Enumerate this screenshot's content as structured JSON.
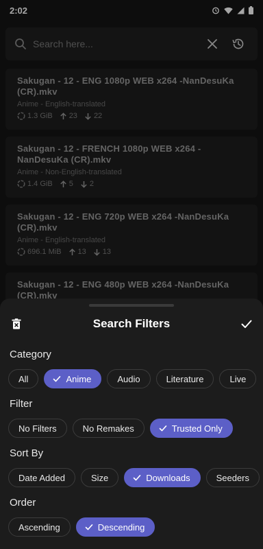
{
  "status": {
    "time": "2:02"
  },
  "search": {
    "placeholder": "Search here..."
  },
  "results": [
    {
      "title": "Sakugan - 12 - ENG 1080p WEB x264 -NanDesuKa (CR).mkv",
      "category": "Anime - English-translated",
      "size": "1.3 GiB",
      "seeders": "23",
      "leechers": "22"
    },
    {
      "title": "Sakugan - 12 - FRENCH 1080p WEB x264 -NanDesuKa (CR).mkv",
      "category": "Anime - Non-English-translated",
      "size": "1.4 GiB",
      "seeders": "5",
      "leechers": "2"
    },
    {
      "title": "Sakugan - 12 - ENG 720p WEB x264 -NanDesuKa (CR).mkv",
      "category": "Anime - English-translated",
      "size": "696.1 MiB",
      "seeders": "13",
      "leechers": "13"
    },
    {
      "title": "Sakugan - 12 - ENG 480p WEB x264 -NanDesuKa (CR).mkv",
      "category": "",
      "size": "",
      "seeders": "",
      "leechers": ""
    }
  ],
  "sheet": {
    "title": "Search Filters",
    "category_label": "Category",
    "categories": [
      "All",
      "Anime",
      "Audio",
      "Literature",
      "Live"
    ],
    "filter_label": "Filter",
    "filters": [
      "No Filters",
      "No Remakes",
      "Trusted Only"
    ],
    "sort_label": "Sort By",
    "sorts": [
      "Date Added",
      "Size",
      "Downloads",
      "Seeders"
    ],
    "order_label": "Order",
    "orders": [
      "Ascending",
      "Descending"
    ]
  },
  "colors": {
    "accent": "#5c5fc7",
    "background": "#141414",
    "card": "#1e1e1e",
    "sheet": "#1c1c1c"
  },
  "icons": {
    "clear": "close-icon",
    "history": "history-icon",
    "delete": "delete-icon",
    "apply": "check-icon",
    "size": "disk-icon",
    "seeders": "arrow-up-icon",
    "leechers": "arrow-down-icon"
  }
}
